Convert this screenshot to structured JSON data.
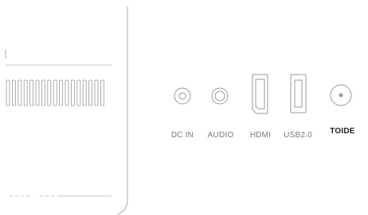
{
  "ports": [
    {
      "id": "dc-in",
      "label": "DC IN",
      "icon": "dc-jack-icon"
    },
    {
      "id": "audio",
      "label": "AUDIO",
      "icon": "audio-jack-icon"
    },
    {
      "id": "hdmi",
      "label": "HDMI",
      "icon": "hdmi-port-icon"
    },
    {
      "id": "usb",
      "label": "USB2.0",
      "icon": "usb-port-icon"
    },
    {
      "id": "toide",
      "label": "TOIDE",
      "icon": "coax-port-icon"
    }
  ],
  "colors": {
    "line": "#9a9a9a",
    "line_light": "#c8c8c8",
    "label": "#7a7a7a",
    "label_strong": "#1f1f1f"
  }
}
